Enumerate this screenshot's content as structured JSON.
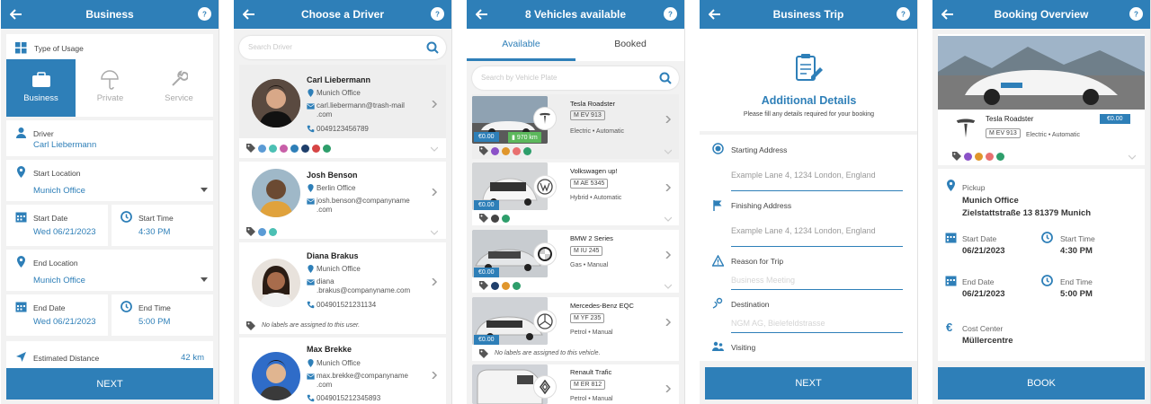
{
  "screen1": {
    "title": "Business",
    "type_of_usage_label": "Type of Usage",
    "usage_options": [
      "Business",
      "Private",
      "Service"
    ],
    "driver_label": "Driver",
    "driver_value": "Carl Liebermann",
    "start_location_label": "Start Location",
    "start_location_value": "Munich Office",
    "start_date_label": "Start Date",
    "start_date_value": "Wed 06/21/2023",
    "start_time_label": "Start Time",
    "start_time_value": "4:30 PM",
    "end_location_label": "End Location",
    "end_location_value": "Munich Office",
    "end_date_label": "End Date",
    "end_date_value": "Wed 06/21/2023",
    "end_time_label": "End Time",
    "end_time_value": "5:00 PM",
    "distance_label": "Estimated Distance",
    "distance_value": "42 km",
    "next_label": "NEXT"
  },
  "screen2": {
    "title": "Choose a Driver",
    "search_placeholder": "Search Driver",
    "drivers": [
      {
        "name": "Carl Liebermann",
        "office": "Munich Office",
        "email1": "carl.liebermann@trash-mail",
        "email2": ".com",
        "phone": "0049123456789"
      },
      {
        "name": "Josh Benson",
        "office": "Berlin Office",
        "email1": "josh.benson@companyname",
        "email2": ".com",
        "phone": ""
      },
      {
        "name": "Diana Brakus",
        "office": "Munich Office",
        "email1": "diana",
        "email2": ".brakus@companyname.com",
        "phone": "004901521231134"
      },
      {
        "name": "Max Brekke",
        "office": "Munich Office",
        "email1": "max.brekke@companyname",
        "email2": ".com",
        "phone": "0049015212345893"
      }
    ],
    "no_labels_text": "No labels are assigned to this user."
  },
  "screen3": {
    "title": "8 Vehicles available",
    "tab_available": "Available",
    "tab_booked": "Booked",
    "search_placeholder": "Search by Vehicle Plate",
    "vehicles": [
      {
        "name": "Tesla Roadster",
        "plate": "M EV 913",
        "type": "Electric • Automatic",
        "price": "€0.00",
        "range": "970 km"
      },
      {
        "name": "Volkswagen up!",
        "plate": "M AE 5345",
        "type": "Hybrid • Automatic",
        "price": "€0.00"
      },
      {
        "name": "BMW 2 Series",
        "plate": "M IU 245",
        "type": "Gas • Manual",
        "price": "€0.00"
      },
      {
        "name": "Mercedes-Benz EQC",
        "plate": "M YF 235",
        "type": "Petrol • Manual",
        "price": "€0.00"
      },
      {
        "name": "Renault Trafic",
        "plate": "M ER 812",
        "type": "Petrol • Manual",
        "price": ""
      }
    ],
    "no_labels_vehicle": "No labels are assigned to this vehicle."
  },
  "screen4": {
    "title": "Business Trip",
    "heading": "Additional Details",
    "subheading": "Please fill any details required for your booking",
    "starting_address_label": "Starting Address",
    "starting_address_placeholder": "Example Lane 4, 1234 London, England",
    "finishing_address_label": "Finishing Address",
    "finishing_address_placeholder": "Example Lane 4, 1234 London, England",
    "reason_label": "Reason for Trip",
    "reason_placeholder": "Business Meeting",
    "destination_label": "Destination",
    "destination_placeholder": "NGM AG, Bielefeldstrasse",
    "visiting_label": "Visiting",
    "next_label": "NEXT"
  },
  "screen5": {
    "title": "Booking Overview",
    "vehicle_name": "Tesla Roadster",
    "vehicle_plate": "M EV 913",
    "vehicle_type": "Electric • Automatic",
    "vehicle_price": "€0.00",
    "pickup_label": "Pickup",
    "pickup_name": "Munich Office",
    "pickup_address": "Zielstattstraße 13 81379 Munich",
    "start_date_label": "Start Date",
    "start_date_value": "06/21/2023",
    "start_time_label": "Start Time",
    "start_time_value": "4:30 PM",
    "end_date_label": "End Date",
    "end_date_value": "06/21/2023",
    "end_time_label": "End Time",
    "end_time_value": "5:00 PM",
    "cost_center_label": "Cost Center",
    "cost_center_value": "Müllercentre",
    "book_label": "BOOK"
  },
  "colors": {
    "primary": "#2e7fb8",
    "green_range": "#5cb85c"
  }
}
